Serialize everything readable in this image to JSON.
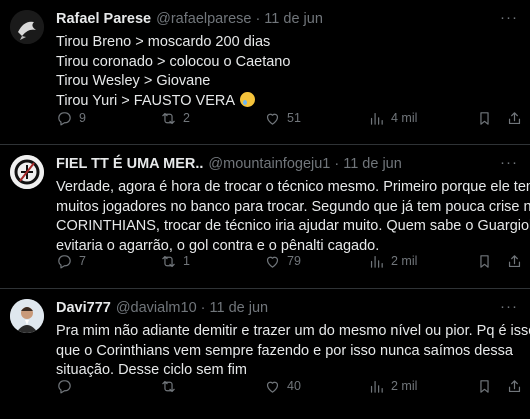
{
  "tweets": [
    {
      "name": "Rafael Parese",
      "handle": "@rafaelparese",
      "separator": "·",
      "date": "11 de jun",
      "lines": [
        "Tirou Breno > moscardo 200 dias",
        "Tirou coronado > colocou o Caetano",
        "Tirou Wesley > Giovane",
        "Tirou Yuri > FAUSTO VERA"
      ],
      "emoji": "crying-face",
      "replies": "9",
      "retweets": "2",
      "likes": "51",
      "views": "4 mil"
    },
    {
      "name": "FIEL TT É UMA MER..",
      "handle": "@mountainfogeju1",
      "separator": "·",
      "date": "11 de jun",
      "lines": [
        "Verdade, agora é hora de trocar o técnico mesmo. Primeiro porque ele tem",
        "muitos jogadores no banco para trocar. Segundo que já tem pouca crise no",
        "CORINTHIANS,  trocar de técnico iria ajudar muito. Quem sabe o Guargiola",
        "evitaria o agarrão, o gol contra e o pênalti cagado."
      ],
      "replies": "7",
      "retweets": "1",
      "likes": "79",
      "views": "2 mil"
    },
    {
      "name": "Davi777",
      "handle": "@davialm10",
      "separator": "·",
      "date": "11 de jun",
      "lines": [
        "Pra mim não adiante demitir e trazer um do mesmo nível ou pior. Pq é isso",
        "que o Corinthians vem sempre fazendo e por isso nunca saímos dessa",
        "situação. Desse ciclo sem fim"
      ],
      "replies": "",
      "retweets": "",
      "likes": "40",
      "views": "2 mil"
    }
  ],
  "more_glyph": "···",
  "colors": {
    "background": "#000000",
    "text": "#e7e9ea",
    "muted": "#71767b",
    "divider": "#2f3336"
  },
  "icons": [
    "reply-icon",
    "retweet-icon",
    "like-icon",
    "views-icon",
    "bookmark-icon",
    "share-icon",
    "more-icon"
  ]
}
